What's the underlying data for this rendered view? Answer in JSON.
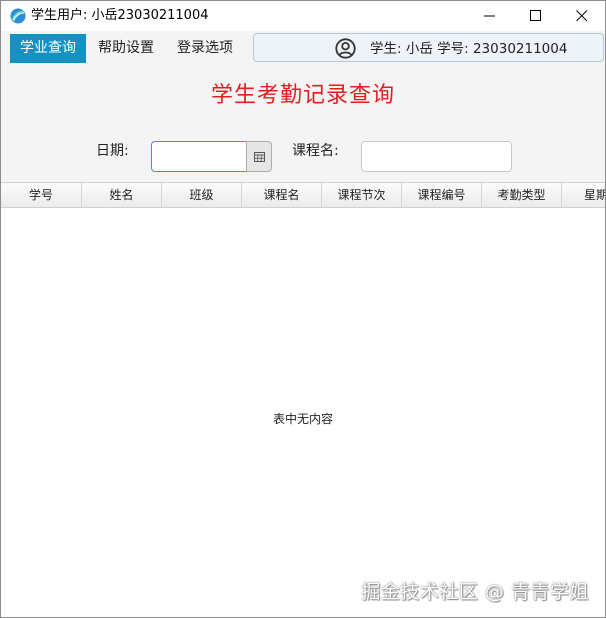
{
  "window": {
    "title": "学生用户: 小岳23030211004"
  },
  "menu": {
    "items": [
      {
        "label": "学业查询",
        "active": true
      },
      {
        "label": "帮助设置",
        "active": false
      },
      {
        "label": "登录选项",
        "active": false
      }
    ]
  },
  "user_panel": {
    "text": "学生: 小岳 学号: 23030211004",
    "icon": "user-circle-icon"
  },
  "page": {
    "title": "学生考勤记录查询"
  },
  "filters": {
    "date_label": "日期:",
    "date_value": "",
    "course_label": "课程名:",
    "course_value": ""
  },
  "table": {
    "columns": [
      "学号",
      "姓名",
      "班级",
      "课程名",
      "课程节次",
      "课程编号",
      "考勤类型",
      "星期"
    ],
    "rows": [],
    "empty_message": "表中无内容"
  },
  "watermark": "掘金技术社区 @ 青青学姐",
  "colors": {
    "accent": "#1691c4",
    "title_red": "#e02020",
    "focus_border": "#2e9bd6"
  }
}
